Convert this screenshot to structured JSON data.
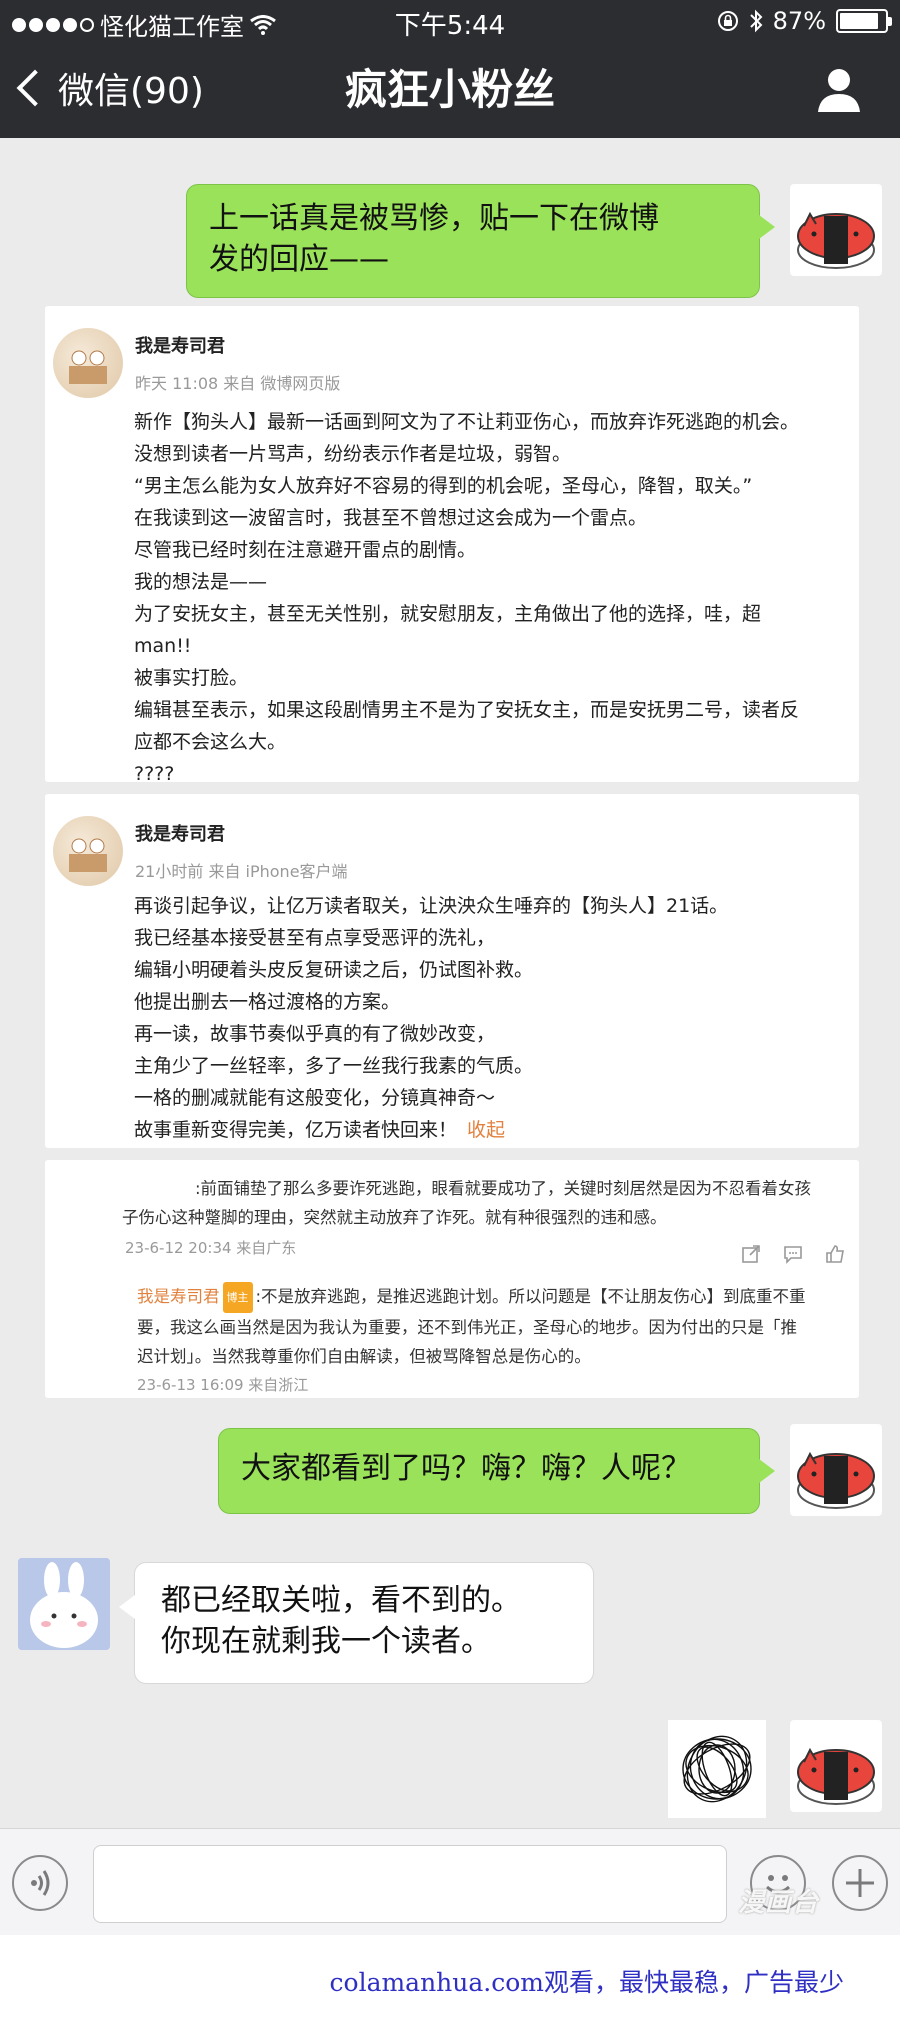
{
  "status_bar": {
    "carrier": "怪化猫工作室",
    "time": "下午5:44",
    "battery": "87%"
  },
  "nav": {
    "back_label": "微信(90)",
    "title": "疯狂小粉丝"
  },
  "messages": {
    "m1": {
      "line1": "上一话真是被骂惨，贴一下在微博",
      "line2": "发的回应——"
    },
    "m2": "大家都看到了吗？嗨？嗨？人呢？",
    "m3": {
      "line1": "都已经取关啦，看不到的。",
      "line2": "你现在就剩我一个读者。"
    }
  },
  "weibo_post_1": {
    "author": "我是寿司君",
    "meta": "昨天 11:08  来自 微博网页版",
    "body": "新作【狗头人】最新一话画到阿文为了不让莉亚伤心，而放弃诈死逃跑的机会。\n没想到读者一片骂声，纷纷表示作者是垃圾，弱智。\n“男主怎么能为女人放弃好不容易的得到的机会呢，圣母心，降智，取关。”\n在我读到这一波留言时，我甚至不曾想过这会成为一个雷点。\n尽管我已经时刻在注意避开雷点的剧情。\n我的想法是——\n为了安抚女主，甚至无关性别，就安慰朋友，主角做出了他的选择，哇，超\nman!!\n被事实打脸。\n编辑甚至表示，如果这段剧情男主不是为了安抚女主，而是安抚男二号，读者反\n应都不会这么大。\n????"
  },
  "weibo_post_2": {
    "author": "我是寿司君",
    "meta": "21小时前  来自 iPhone客户端",
    "body": "再谈引起争议，让亿万读者取关，让泱泱众生唾弃的【狗头人】21话。\n我已经基本接受甚至有点享受恶评的洗礼，\n编辑小明硬着头皮反复研读之后，仍试图补救。\n他提出删去一格过渡格的方案。\n再一读，故事节奏似乎真的有了微妙改变，\n主角少了一丝轻率，多了一丝我行我素的气质。\n一格的删减就能有这般变化，分镜真神奇～\n故事重新变得完美，亿万读者快回来！",
    "collapse": "收起"
  },
  "comment": {
    "line1": ":前面铺垫了那么多要诈死逃跑，眼看就要成功了，关键时刻居然是因为不忍看着女孩",
    "line2": "子伤心这种蹩脚的理由，突然就主动放弃了诈死。就有种很强烈的违和感。",
    "meta": "23-6-12 20:34 来自广东",
    "reply_author": "我是寿司君",
    "reply_badge": "博主",
    "reply_line1": ":不是放弃逃跑，是推迟逃跑计划。所以问题是【不让朋友伤心】到底重不重",
    "reply_line2": "要，我这么画当然是因为我认为重要，还不到伟光正，圣母心的地步。因为付出的只是「推",
    "reply_line3": "迟计划」。当然我尊重你们自由解读，但被骂降智总是伤心的。",
    "reply_meta": "23-6-13 16:09 来自浙江"
  },
  "footer": {
    "ad": "colamanhua.com观看，最快最稳，广告最少",
    "watermark": "漫画台"
  },
  "colors": {
    "green_bubble": "#9be25b",
    "nav_bg": "#2c2d31",
    "chat_bg": "#ebebeb",
    "accent_orange": "#e2813d"
  }
}
